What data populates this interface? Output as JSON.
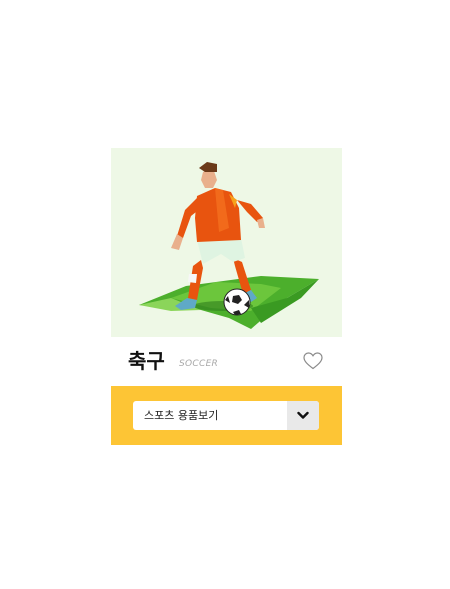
{
  "card": {
    "title": "축구",
    "subtitle": "SOCCER",
    "select": {
      "value": "스포츠 용품보기"
    }
  },
  "colors": {
    "image_bg": "#eef8e6",
    "footer_bg": "#fdc535",
    "arrow_bg": "#e9e9e9"
  },
  "icons": {
    "favorite": "heart-icon",
    "dropdown": "chevron-down-icon",
    "illustration": "soccer-player-illustration"
  }
}
